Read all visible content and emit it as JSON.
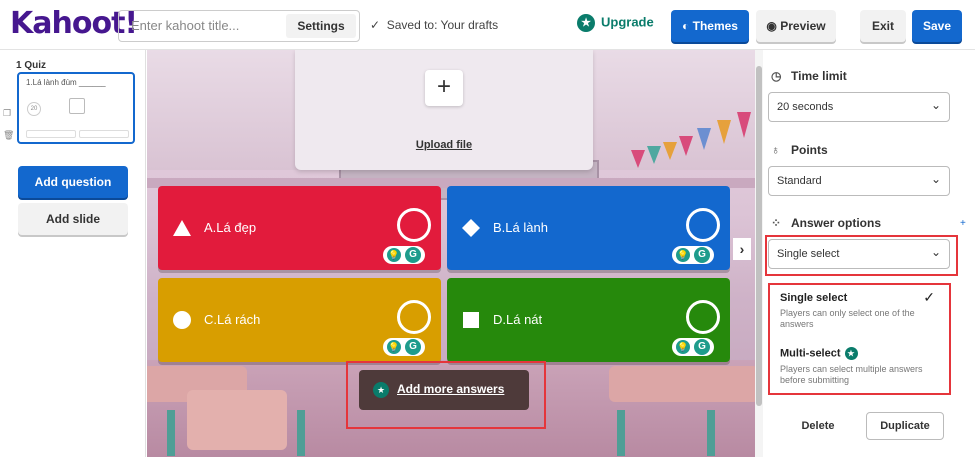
{
  "header": {
    "logo": "Kahoot!",
    "title_placeholder": "Enter kahoot title...",
    "settings_label": "Settings",
    "saved_text": "Saved to: Your drafts",
    "upgrade_label": "Upgrade",
    "themes_label": "Themes",
    "preview_label": "Preview",
    "exit_label": "Exit",
    "save_label": "Save"
  },
  "sidebar": {
    "slide_label": "1  Quiz",
    "slide_title": "1.Lá lành đùm ______",
    "slide_timer": "20",
    "add_question_label": "Add question",
    "add_slide_label": "Add slide"
  },
  "canvas": {
    "upload_label": "Upload file",
    "answers": [
      {
        "label": "A.Lá đẹp",
        "shape": "triangle",
        "color": "#e21b3c"
      },
      {
        "label": "B.Lá lành",
        "shape": "diamond",
        "color": "#1368ce"
      },
      {
        "label": "C.Lá rách",
        "shape": "circle",
        "color": "#d89e00"
      },
      {
        "label": "D.Lá nát",
        "shape": "square",
        "color": "#26890c"
      }
    ],
    "add_more_label": "Add more answers"
  },
  "panel": {
    "time_limit_label": "Time limit",
    "time_limit_value": "20 seconds",
    "points_label": "Points",
    "points_value": "Standard",
    "answer_options_label": "Answer options",
    "answer_options_value": "Single select",
    "options": [
      {
        "title": "Single select",
        "desc": "Players can only select one of the answers"
      },
      {
        "title": "Multi-select",
        "desc": "Players can select multiple answers before submitting"
      }
    ],
    "delete_label": "Delete",
    "duplicate_label": "Duplicate"
  }
}
